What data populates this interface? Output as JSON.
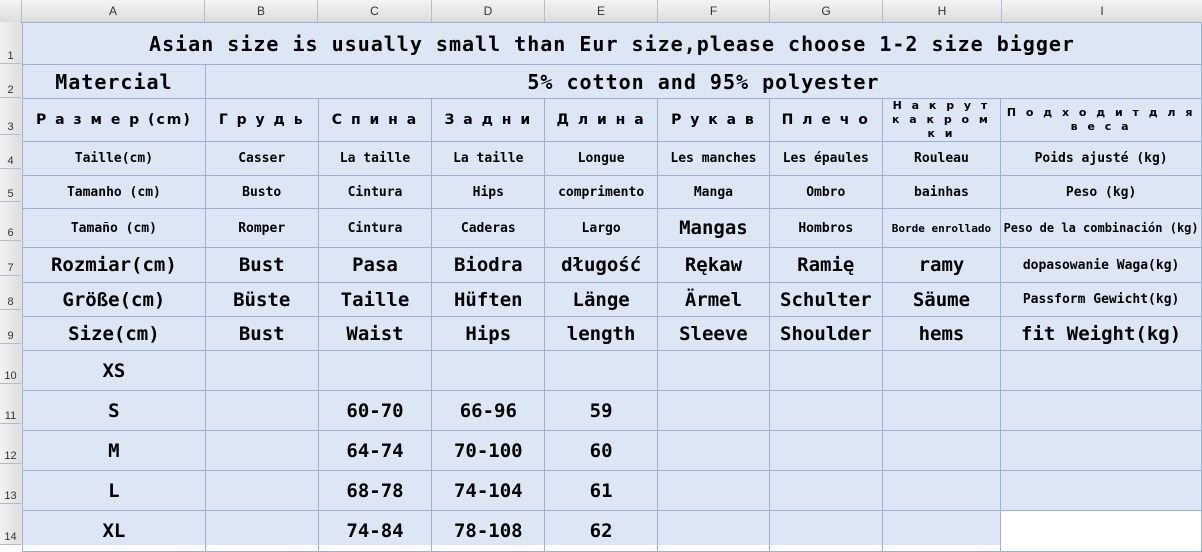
{
  "column_headers": [
    "A",
    "B",
    "C",
    "D",
    "E",
    "F",
    "G",
    "H",
    "I"
  ],
  "row_headers": [
    "1",
    "2",
    "3",
    "4",
    "5",
    "6",
    "7",
    "8",
    "9",
    "10",
    "11",
    "12",
    "13",
    "14"
  ],
  "title": "Asian size is usually small than Eur size,please choose 1-2 size bigger",
  "material": {
    "label": "Matercial",
    "value": "5% cotton and 95% polyester"
  },
  "header_rows": [
    [
      "Р а з м е р (cm)",
      "Г р у д ь",
      "С п и н а",
      "З а д н и",
      "Д л и н а",
      "Р у к а в",
      "П л е ч о",
      "Н а к р у т к а к р о м к и",
      "П о д х о д и т  д л я  в е с а"
    ],
    [
      "Taille(cm)",
      "Casser",
      "La taille",
      "La taille",
      "Longue",
      "Les manches",
      "Les épaules",
      "Rouleau",
      "Poids ajusté (kg)"
    ],
    [
      "Tamanho (cm)",
      "Busto",
      "Cintura",
      "Hips",
      "comprimento",
      "Manga",
      "Ombro",
      "bainhas",
      "Peso (kg)"
    ],
    [
      "Tamaño (cm)",
      "Romper",
      "Cintura",
      "Caderas",
      "Largo",
      "Mangas",
      "Hombros",
      "Borde enrollado",
      "Peso de la combinación (kg)"
    ],
    [
      "Rozmiar(cm)",
      "Bust",
      "Pasa",
      "Biodra",
      "długość",
      "Rękaw",
      "Ramię",
      "ramy",
      "dopasowanie Waga(kg)"
    ],
    [
      "Größe(cm)",
      "Büste",
      "Taille",
      "Hüften",
      "Länge",
      "Ärmel",
      "Schulter",
      "Säume",
      "Passform Gewicht(kg)"
    ],
    [
      "Size(cm)",
      "Bust",
      "Waist",
      "Hips",
      "length",
      "Sleeve",
      "Shoulder",
      "hems",
      "fit Weight(kg)"
    ]
  ],
  "size_rows": [
    {
      "size": "XS",
      "bust": "",
      "waist": "",
      "hips": "",
      "length": "",
      "sleeve": "",
      "shoulder": "",
      "hems": "",
      "weight": ""
    },
    {
      "size": "S",
      "bust": "",
      "waist": "60-70",
      "hips": "66-96",
      "length": "59",
      "sleeve": "",
      "shoulder": "",
      "hems": "",
      "weight": ""
    },
    {
      "size": "M",
      "bust": "",
      "waist": "64-74",
      "hips": "70-100",
      "length": "60",
      "sleeve": "",
      "shoulder": "",
      "hems": "",
      "weight": ""
    },
    {
      "size": "L",
      "bust": "",
      "waist": "68-78",
      "hips": "74-104",
      "length": "61",
      "sleeve": "",
      "shoulder": "",
      "hems": "",
      "weight": ""
    },
    {
      "size": "XL",
      "bust": "",
      "waist": "74-84",
      "hips": "78-108",
      "length": "62",
      "sleeve": "",
      "shoulder": "",
      "hems": "",
      "weight": ""
    }
  ]
}
